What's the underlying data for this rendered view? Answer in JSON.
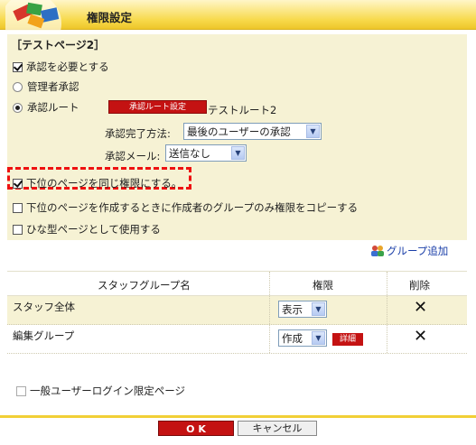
{
  "header": {
    "title": "権限設定"
  },
  "settings": {
    "page_name": "［テストページ2］",
    "require_approval": {
      "label": "承認を必要とする",
      "checked": true
    },
    "admin_approval": {
      "label": "管理者承認",
      "selected": false
    },
    "approval_route": {
      "label": "承認ルート",
      "selected": true
    },
    "route_button": "承認ルート設定",
    "route_name": "テストルート2",
    "completion_method": {
      "label": "承認完了方法:",
      "value": "最後のユーザーの承認"
    },
    "approval_mail": {
      "label": "承認メール:",
      "value": "送信なし"
    },
    "same_permission": {
      "label": "下位のページを同じ権限にする。",
      "checked": true
    },
    "copy_permission": {
      "label": "下位のページを作成するときに作成者のグループのみ権限をコピーする",
      "checked": false
    },
    "template_use": {
      "label": "ひな型ページとして使用する",
      "checked": false
    }
  },
  "add_group": "グループ追加",
  "table": {
    "headers": {
      "name": "スタッフグループ名",
      "permission": "権限",
      "delete": "削除"
    },
    "rows": [
      {
        "name": "スタッフ全体",
        "permission": "表示",
        "detail": ""
      },
      {
        "name": "編集グループ",
        "permission": "作成",
        "detail": "詳細"
      }
    ]
  },
  "login_only": {
    "label": "一般ユーザーログイン限定ページ",
    "checked": false
  },
  "buttons": {
    "ok": "O K",
    "cancel": "キャンセル"
  },
  "colors": {
    "accent_red": "#c41212",
    "panel_bg": "#f6f2d4",
    "header_yellow": "#f7d94a",
    "highlight_dash": "#e11111"
  },
  "icons": [
    "logo-icon",
    "checkbox-icon",
    "radio-icon",
    "dropdown-arrow-icon",
    "group-add-icon",
    "delete-x-icon"
  ]
}
